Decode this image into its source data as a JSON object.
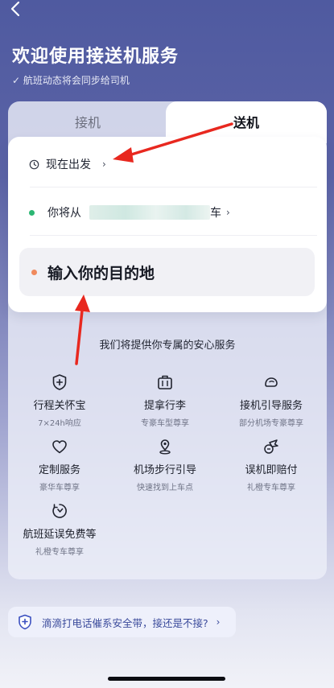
{
  "header": {
    "title": "欢迎使用接送机服务",
    "subtitle": "✓ 航班动态将会同步给司机"
  },
  "tabs": [
    {
      "label": "接机",
      "active": false
    },
    {
      "label": "送机",
      "active": true
    }
  ],
  "form": {
    "time_label": "现在出发",
    "from_prefix": "你将从",
    "from_suffix": "车",
    "destination_placeholder": "输入你的目的地"
  },
  "colors": {
    "from_dot": "#2bb673",
    "destination_dot": "#f08a5d",
    "annotation_arrow": "#e8281f"
  },
  "services": {
    "heading": "我们将提供你专属的安心服务",
    "items": [
      {
        "name": "行程关怀宝",
        "desc": "7×24h响应",
        "icon": "shield-plus-icon"
      },
      {
        "name": "提拿行李",
        "desc": "专豪车型尊享",
        "icon": "suitcase-icon"
      },
      {
        "name": "接机引导服务",
        "desc": "部分机场专豪尊享",
        "icon": "guide-icon"
      },
      {
        "name": "定制服务",
        "desc": "豪华车尊享",
        "icon": "heart-icon"
      },
      {
        "name": "机场步行引导",
        "desc": "快速找到上车点",
        "icon": "location-pin-icon"
      },
      {
        "name": "误机即赔付",
        "desc": "礼橙专车尊享",
        "icon": "plane-icon"
      },
      {
        "name": "航班延误免费等",
        "desc": "礼橙专车尊享",
        "icon": "timer-icon"
      }
    ]
  },
  "banner": {
    "text": "滴滴打电话催系安全带，接还是不接?",
    "icon": "shield-plus-icon"
  }
}
